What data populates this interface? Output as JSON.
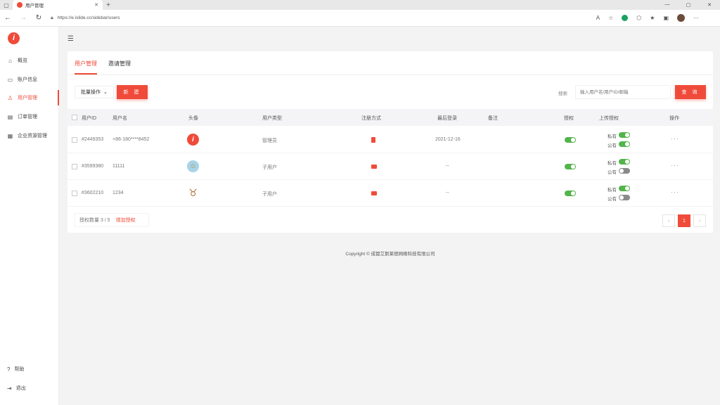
{
  "browser": {
    "tab_title": "用户管理",
    "url": "https://e.islide.cc/sidebar/users"
  },
  "sidebar": {
    "logo_text": "i",
    "items": [
      {
        "label": "概览",
        "icon": "home-icon"
      },
      {
        "label": "账户信息",
        "icon": "card-icon"
      },
      {
        "label": "用户管理",
        "icon": "user-icon"
      },
      {
        "label": "订单管理",
        "icon": "clipboard-icon"
      },
      {
        "label": "企业资源管理",
        "icon": "stack-icon"
      }
    ],
    "bottom": [
      {
        "label": "帮助",
        "icon": "help-icon"
      },
      {
        "label": "退出",
        "icon": "logout-icon"
      }
    ]
  },
  "tabs": [
    "用户管理",
    "邀请管理"
  ],
  "toolbar": {
    "batch_label": "批量操作",
    "new_label": "新 建",
    "search_label": "搜索",
    "search_placeholder": "输入用户名/用户ID/邮箱",
    "search_button": "查 询"
  },
  "table": {
    "headers": [
      "用户ID",
      "用户名",
      "头像",
      "用户类型",
      "注册方式",
      "最后登录",
      "备注",
      "授权",
      "上传授权",
      "操作"
    ],
    "rows": [
      {
        "id": "#2449353",
        "name": "+86-180****8452",
        "type": "管理员",
        "last_login": "2021-12-16",
        "note": "",
        "private_label": "私有",
        "public_label": "公有",
        "more": "···"
      },
      {
        "id": "#3599380",
        "name": "11111",
        "type": "子用户",
        "last_login": "--",
        "note": "",
        "private_label": "私有",
        "public_label": "公有",
        "more": "···"
      },
      {
        "id": "#3602210",
        "name": "1234",
        "type": "子用户",
        "last_login": "--",
        "note": "",
        "private_label": "私有",
        "public_label": "公有",
        "more": "···"
      }
    ]
  },
  "footer": {
    "quota": "授权数量 3 / 5",
    "add_auth": "增加授权",
    "pager_prev": "‹",
    "pager_current": "1",
    "pager_next": "›"
  },
  "copyright": "Copyright © 成都艾斯莱德网络科技有限公司",
  "colors": {
    "accent": "#f04b3a",
    "toggle_on": "#52b44a",
    "toggle_off": "#8a8a8a"
  }
}
